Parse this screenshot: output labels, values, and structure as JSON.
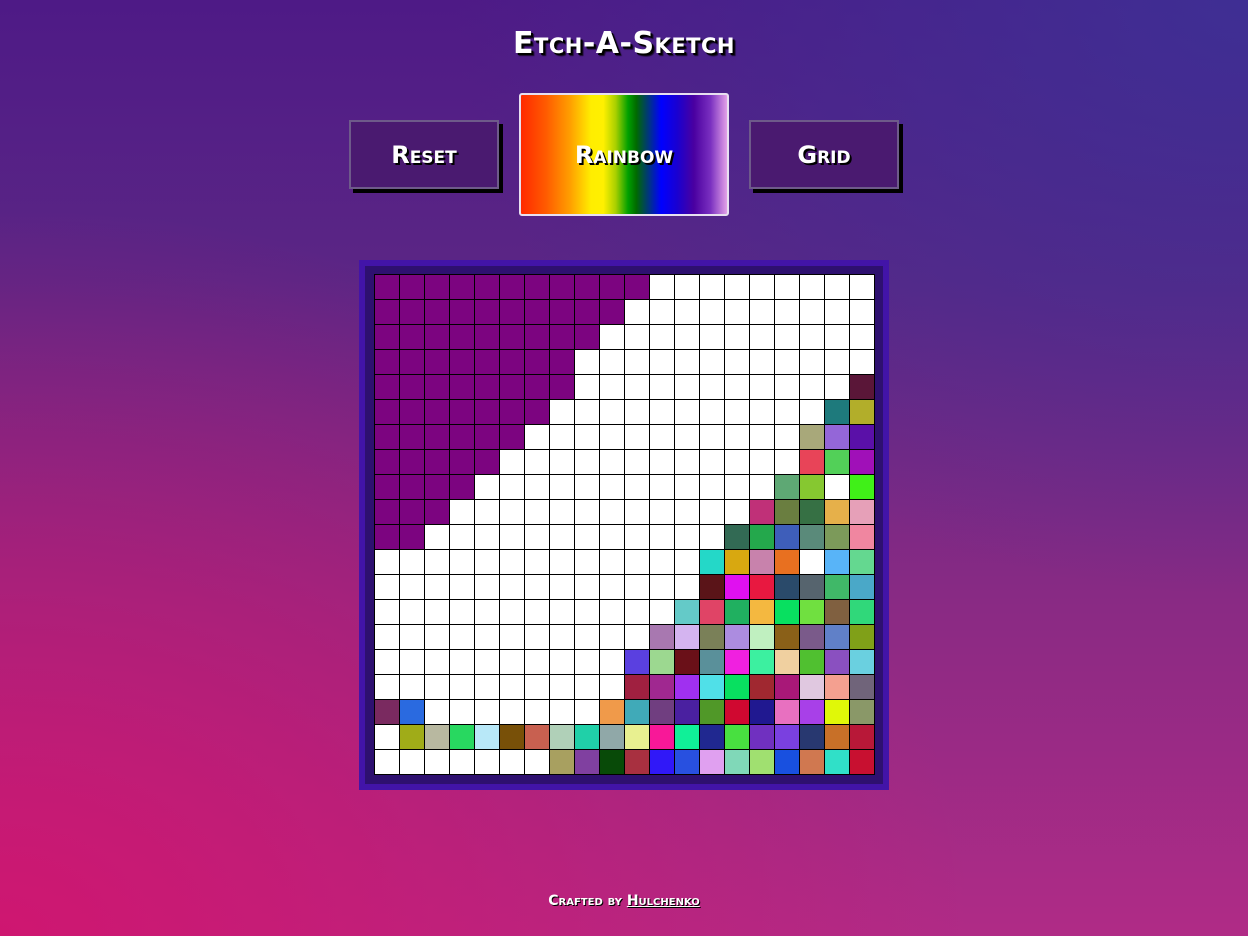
{
  "app": {
    "title": "Etch-A-Sketch"
  },
  "controls": {
    "reset_label": "Reset",
    "rainbow_label": "Rainbow",
    "grid_label": "Grid"
  },
  "footer": {
    "prefix": "Crafted by",
    "author": "Hulchenko"
  },
  "colors": {
    "purple_fill": "#7c0480",
    "white": "#ffffff",
    "board_border": "#4214a8"
  },
  "grid_colors": {
    "size": 20,
    "purple_counts": [
      11,
      10,
      9,
      8,
      8,
      7,
      6,
      5,
      4,
      3,
      2,
      0,
      0,
      0,
      0,
      0,
      0,
      0,
      0,
      0
    ],
    "rainbow_rows": [
      [],
      [],
      [],
      [],
      [
        "#5a1638"
      ],
      [
        "#1e7a7c",
        "#b2ae2a"
      ],
      [
        "#a8a87a",
        "#9466d8",
        "#5a10a8"
      ],
      [
        "#e84458",
        "#52d058",
        "#a010b8"
      ],
      [
        "#5ea874",
        "#86c830",
        "#ffffff",
        "#40f018"
      ],
      [
        "#c03078",
        "#6a7e40",
        "#367044",
        "#e6b04a",
        "#e6a0b8"
      ],
      [
        "#326a54",
        "#24a84c",
        "#3e5eba",
        "#5a8a7a",
        "#7c9a5a",
        "#f086a0"
      ],
      [
        "#24d8c8",
        "#d8a810",
        "#c882ac",
        "#e87020",
        "#ffffff",
        "#58b4f8",
        "#64d890"
      ],
      [
        "#5a1418",
        "#e010f0",
        "#e81840",
        "#2a4a6a",
        "#56646e",
        "#40b868",
        "#4aa8c8"
      ],
      [
        "#64cac8",
        "#e04466",
        "#20b060",
        "#f4b840",
        "#08e060",
        "#70e040",
        "#806040",
        "#30d87a"
      ],
      [
        "#a878b0",
        "#d4b4f0",
        "#7a8058",
        "#ac8ce0",
        "#c0f0c0",
        "#8a6018",
        "#7a5a8a",
        "#6080c8",
        "#80a018"
      ],
      [
        "#5a40e0",
        "#9cd890",
        "#6a1018",
        "#5a909a",
        "#f020e0",
        "#3cf0a0",
        "#f0d0a0",
        "#50c030",
        "#8a50c0",
        "#6ad0e0"
      ],
      [
        "#a02040",
        "#a02890",
        "#a030f0",
        "#50e0e8",
        "#08e060",
        "#a02830",
        "#a81878",
        "#e0c8e0",
        "#f4a090",
        "#70647a"
      ],
      [
        "#f09a4a",
        "#40aab8",
        "#703e80",
        "#4a20a0",
        "#509828",
        "#d00830",
        "#201890",
        "#e870c0",
        "#a840e8",
        "#e0f808",
        "#8a9868"
      ],
      [
        "#8a9880",
        "#20d0a8",
        "#90a8a8",
        "#e8f090",
        "#f81898",
        "#10f098",
        "#202890",
        "#48e040",
        "#7030c0",
        "#7a40e0",
        "#283870",
        "#c87028",
        "#b81838"
      ],
      [
        "#a8a060",
        "#8040a0",
        "#084a08",
        "#a83040",
        "#3018f8",
        "#2850e0",
        "#e0a0f0",
        "#80d8b8",
        "#a0e070",
        "#1850e0",
        "#d07850",
        "#30e0c8",
        "#c81030"
      ]
    ],
    "bottom_left": {
      "17": {
        "0": "#7a2a60",
        "1": "#2a6ae0"
      },
      "18": {
        "1": "#a0ac18",
        "2": "#b8b8a0",
        "3": "#28d860",
        "4": "#b8e8f8",
        "5": "#785008",
        "6": "#c86050",
        "7": "#b0d0b8"
      }
    }
  }
}
